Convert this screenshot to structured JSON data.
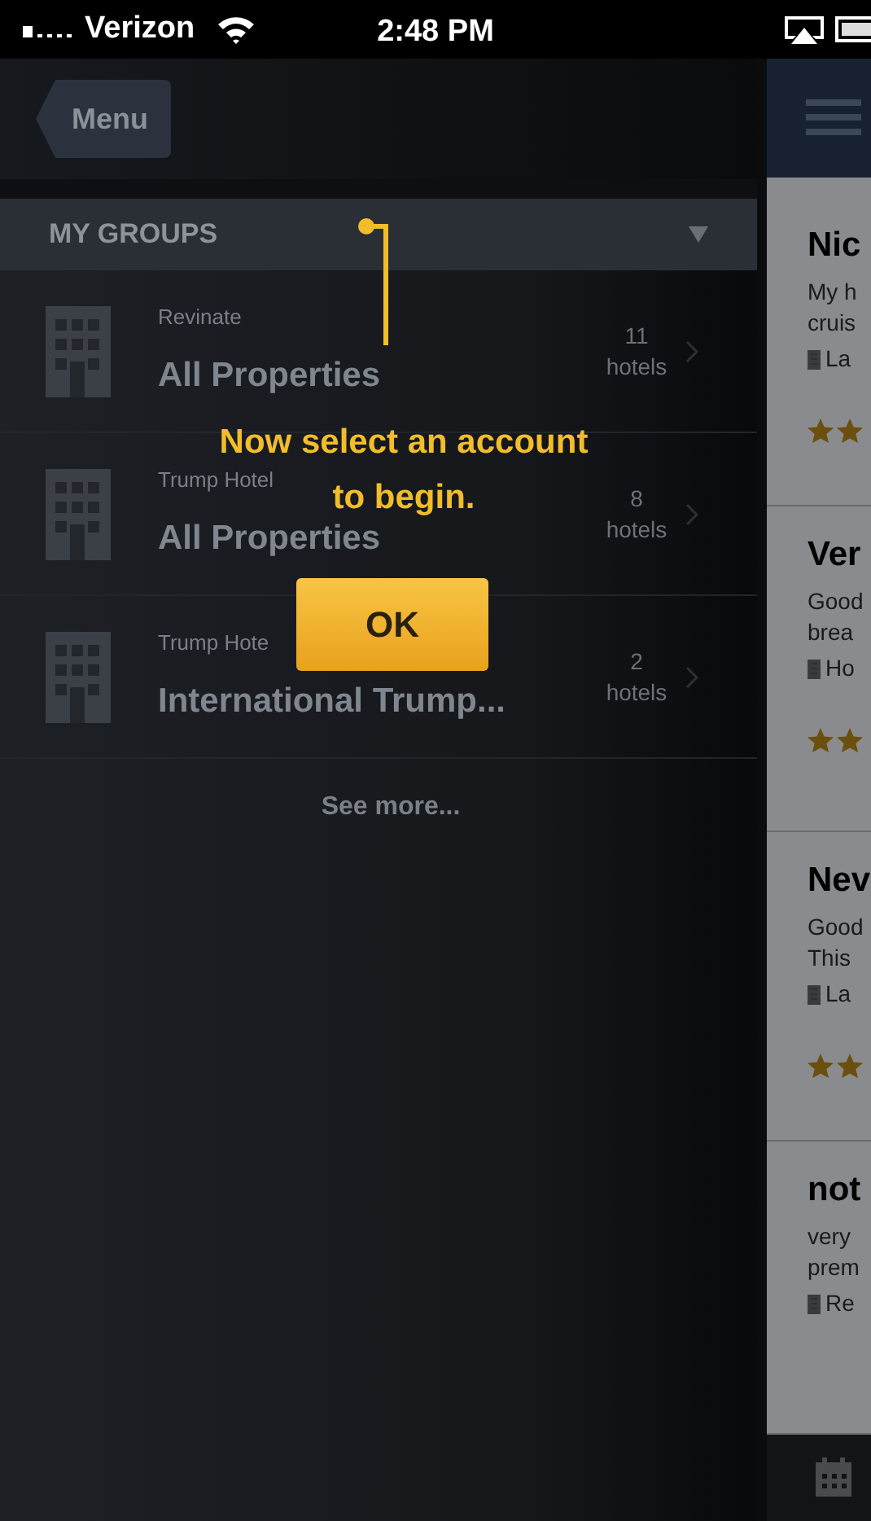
{
  "status_bar": {
    "carrier": "Verizon",
    "time": "2:48 PM"
  },
  "nav": {
    "back_button": "Menu"
  },
  "groups": {
    "title": "MY GROUPS",
    "expanded": true,
    "items": [
      {
        "account": "Revinate",
        "name": "All Properties",
        "count": "11",
        "unit": "hotels"
      },
      {
        "account": "Trump Hotel",
        "name": "All Properties",
        "count": "8",
        "unit": "hotels"
      },
      {
        "account": "Trump Hote",
        "name": "International Trump...",
        "count": "2",
        "unit": "hotels"
      }
    ],
    "see_more": "See more..."
  },
  "coach_mark": {
    "message_lines": [
      "Now select an account",
      "to begin."
    ],
    "button": "OK"
  },
  "reviews": [
    {
      "title": "Nic",
      "lines": [
        "My h",
        "cruis"
      ],
      "hotel": "La",
      "kind": "rated"
    },
    {
      "title": "Ver",
      "lines": [
        "Good",
        "brea"
      ],
      "hotel": "Ho",
      "kind": "rated"
    },
    {
      "title": "Nev",
      "lines": [
        "Good",
        "This"
      ],
      "hotel": "La",
      "kind": "rated"
    },
    {
      "title": "not",
      "lines": [
        "very",
        "prem"
      ],
      "hotel": "Re",
      "kind": "plain"
    }
  ]
}
